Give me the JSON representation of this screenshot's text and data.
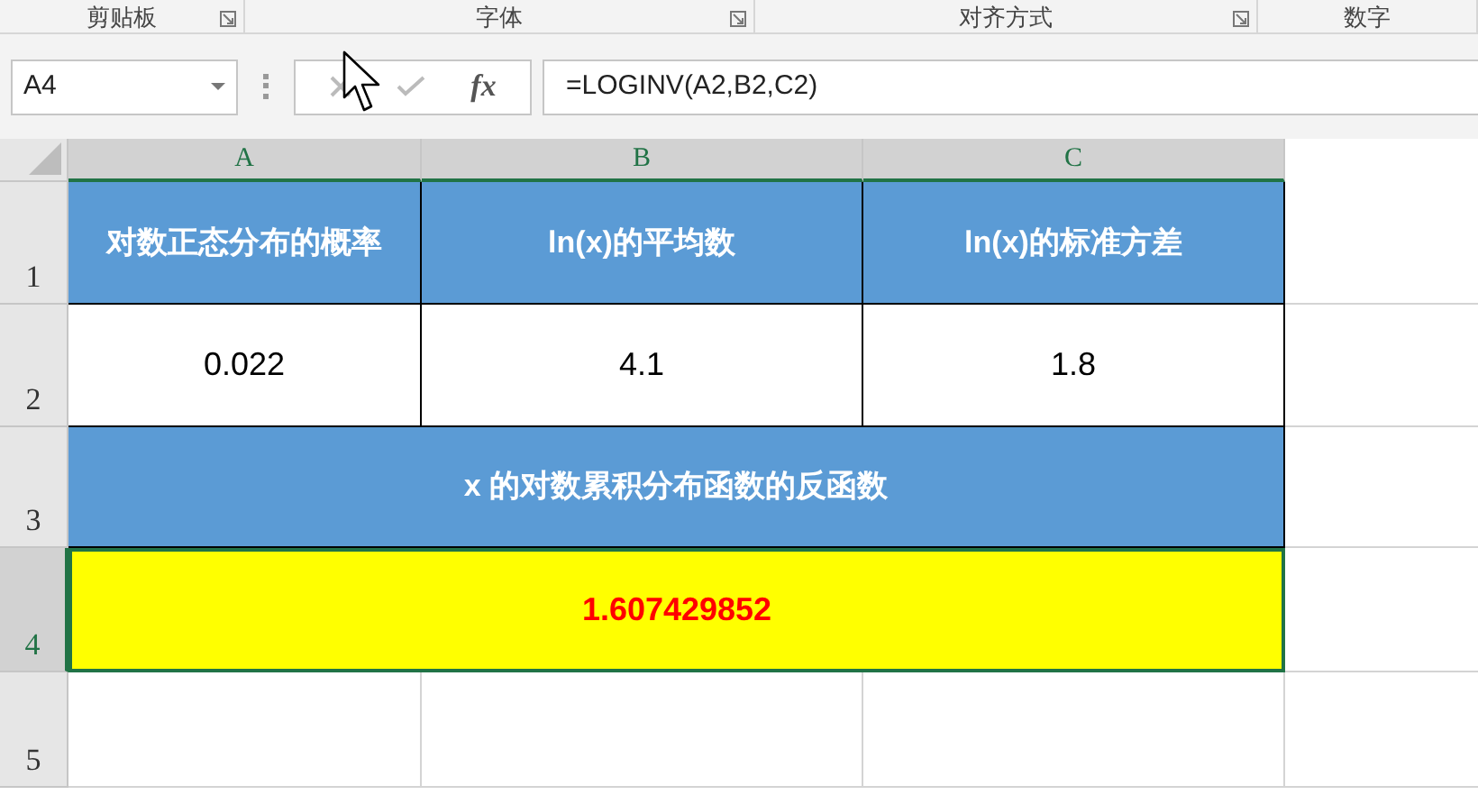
{
  "ribbon_groups": [
    {
      "label": "剪贴板",
      "launcher": true
    },
    {
      "label": "字体",
      "launcher": true
    },
    {
      "label": "对齐方式",
      "launcher": true
    },
    {
      "label": "数字",
      "launcher": false
    }
  ],
  "name_box": {
    "value": "A4"
  },
  "formula_bar": {
    "fx": "fx",
    "formula": "=LOGINV(A2,B2,C2)"
  },
  "columns": [
    {
      "label": "A",
      "selected": true
    },
    {
      "label": "B",
      "selected": true
    },
    {
      "label": "C",
      "selected": true
    }
  ],
  "rows": [
    {
      "label": "1",
      "selected": false,
      "cells": [
        {
          "kind": "header",
          "merged": false,
          "text": "对数正态分布的概率"
        },
        {
          "kind": "header",
          "merged": false,
          "text": "ln(x)的平均数"
        },
        {
          "kind": "header",
          "merged": false,
          "text": "ln(x)的标准方差"
        }
      ]
    },
    {
      "label": "2",
      "selected": false,
      "cells": [
        {
          "kind": "value",
          "merged": false,
          "text": "0.022"
        },
        {
          "kind": "value",
          "merged": false,
          "text": "4.1"
        },
        {
          "kind": "value",
          "merged": false,
          "text": "1.8"
        }
      ]
    },
    {
      "label": "3",
      "selected": false,
      "cells": [
        {
          "kind": "header",
          "merged": true,
          "text": "x 的对数累积分布函数的反函数"
        }
      ]
    },
    {
      "label": "4",
      "selected": true,
      "cells": [
        {
          "kind": "result",
          "merged": true,
          "text": "1.607429852"
        }
      ]
    },
    {
      "label": "5",
      "selected": false,
      "cells": []
    }
  ]
}
